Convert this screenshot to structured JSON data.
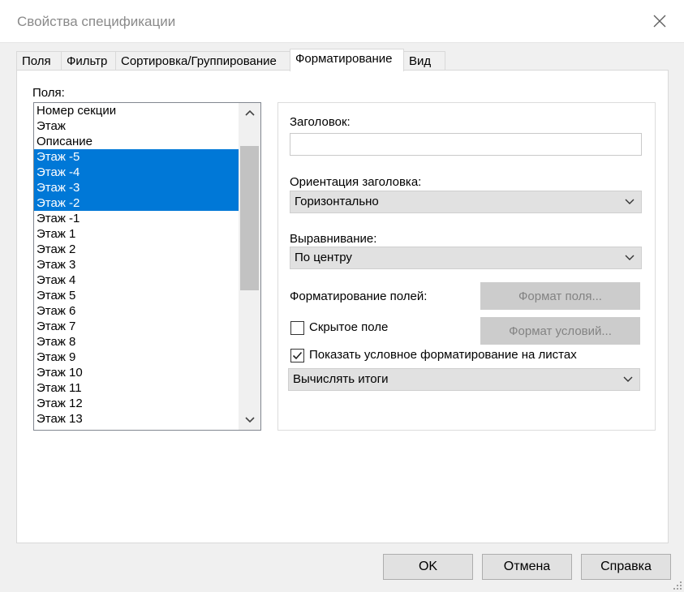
{
  "window": {
    "title": "Свойства спецификации"
  },
  "tabs": [
    {
      "label": "Поля"
    },
    {
      "label": "Фильтр"
    },
    {
      "label": "Сортировка/Группирование"
    },
    {
      "label": "Форматирование"
    },
    {
      "label": "Вид"
    }
  ],
  "fields": {
    "label": "Поля:",
    "items": [
      {
        "label": "Номер секции",
        "selected": false
      },
      {
        "label": "Этаж",
        "selected": false
      },
      {
        "label": "Описание",
        "selected": false
      },
      {
        "label": "Этаж -5",
        "selected": true
      },
      {
        "label": "Этаж -4",
        "selected": true
      },
      {
        "label": "Этаж -3",
        "selected": true
      },
      {
        "label": "Этаж -2",
        "selected": true
      },
      {
        "label": "Этаж -1",
        "selected": false
      },
      {
        "label": "Этаж 1",
        "selected": false
      },
      {
        "label": "Этаж 2",
        "selected": false
      },
      {
        "label": "Этаж 3",
        "selected": false
      },
      {
        "label": "Этаж 4",
        "selected": false
      },
      {
        "label": "Этаж 5",
        "selected": false
      },
      {
        "label": "Этаж 6",
        "selected": false
      },
      {
        "label": "Этаж 7",
        "selected": false
      },
      {
        "label": "Этаж 8",
        "selected": false
      },
      {
        "label": "Этаж 9",
        "selected": false
      },
      {
        "label": "Этаж 10",
        "selected": false
      },
      {
        "label": "Этаж 11",
        "selected": false
      },
      {
        "label": "Этаж 12",
        "selected": false
      },
      {
        "label": "Этаж 13",
        "selected": false
      }
    ]
  },
  "format": {
    "heading_label": "Заголовок:",
    "heading_value": "",
    "orientation_label": "Ориентация заголовка:",
    "orientation_value": "Горизонтально",
    "alignment_label": "Выравнивание:",
    "alignment_value": "По центру",
    "field_format_label": "Форматирование полей:",
    "field_format_button": "Формат поля...",
    "conditional_format_button": "Формат условий...",
    "hidden_field_label": "Скрытое поле",
    "hidden_field_checked": false,
    "show_conditional_label": "Показать условное форматирование на листах",
    "show_conditional_checked": true,
    "totals_value": "Вычислять итоги"
  },
  "buttons": {
    "ok": "OK",
    "cancel": "Отмена",
    "help": "Справка"
  },
  "colors": {
    "selection": "#0078d7",
    "panel": "#ffffff",
    "background": "#f0f0f0"
  }
}
